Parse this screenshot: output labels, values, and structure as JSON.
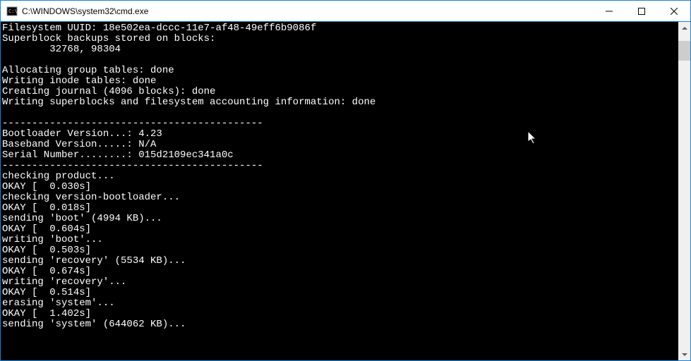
{
  "window": {
    "title": "C:\\WINDOWS\\system32\\cmd.exe"
  },
  "terminal": {
    "lines": [
      "Filesystem UUID: 18e502ea-dccc-11e7-af48-49eff6b9086f",
      "Superblock backups stored on blocks:",
      "        32768, 98304",
      "",
      "Allocating group tables: done",
      "Writing inode tables: done",
      "Creating journal (4096 blocks): done",
      "Writing superblocks and filesystem accounting information: done",
      "",
      "--------------------------------------------",
      "Bootloader Version...: 4.23",
      "Baseband Version.....: N/A",
      "Serial Number........: 015d2109ec341a0c",
      "--------------------------------------------",
      "checking product...",
      "OKAY [  0.030s]",
      "checking version-bootloader...",
      "OKAY [  0.018s]",
      "sending 'boot' (4994 KB)...",
      "OKAY [  0.604s]",
      "writing 'boot'...",
      "OKAY [  0.503s]",
      "sending 'recovery' (5534 KB)...",
      "OKAY [  0.674s]",
      "writing 'recovery'...",
      "OKAY [  0.514s]",
      "erasing 'system'...",
      "OKAY [  1.402s]",
      "sending 'system' (644062 KB)..."
    ]
  }
}
